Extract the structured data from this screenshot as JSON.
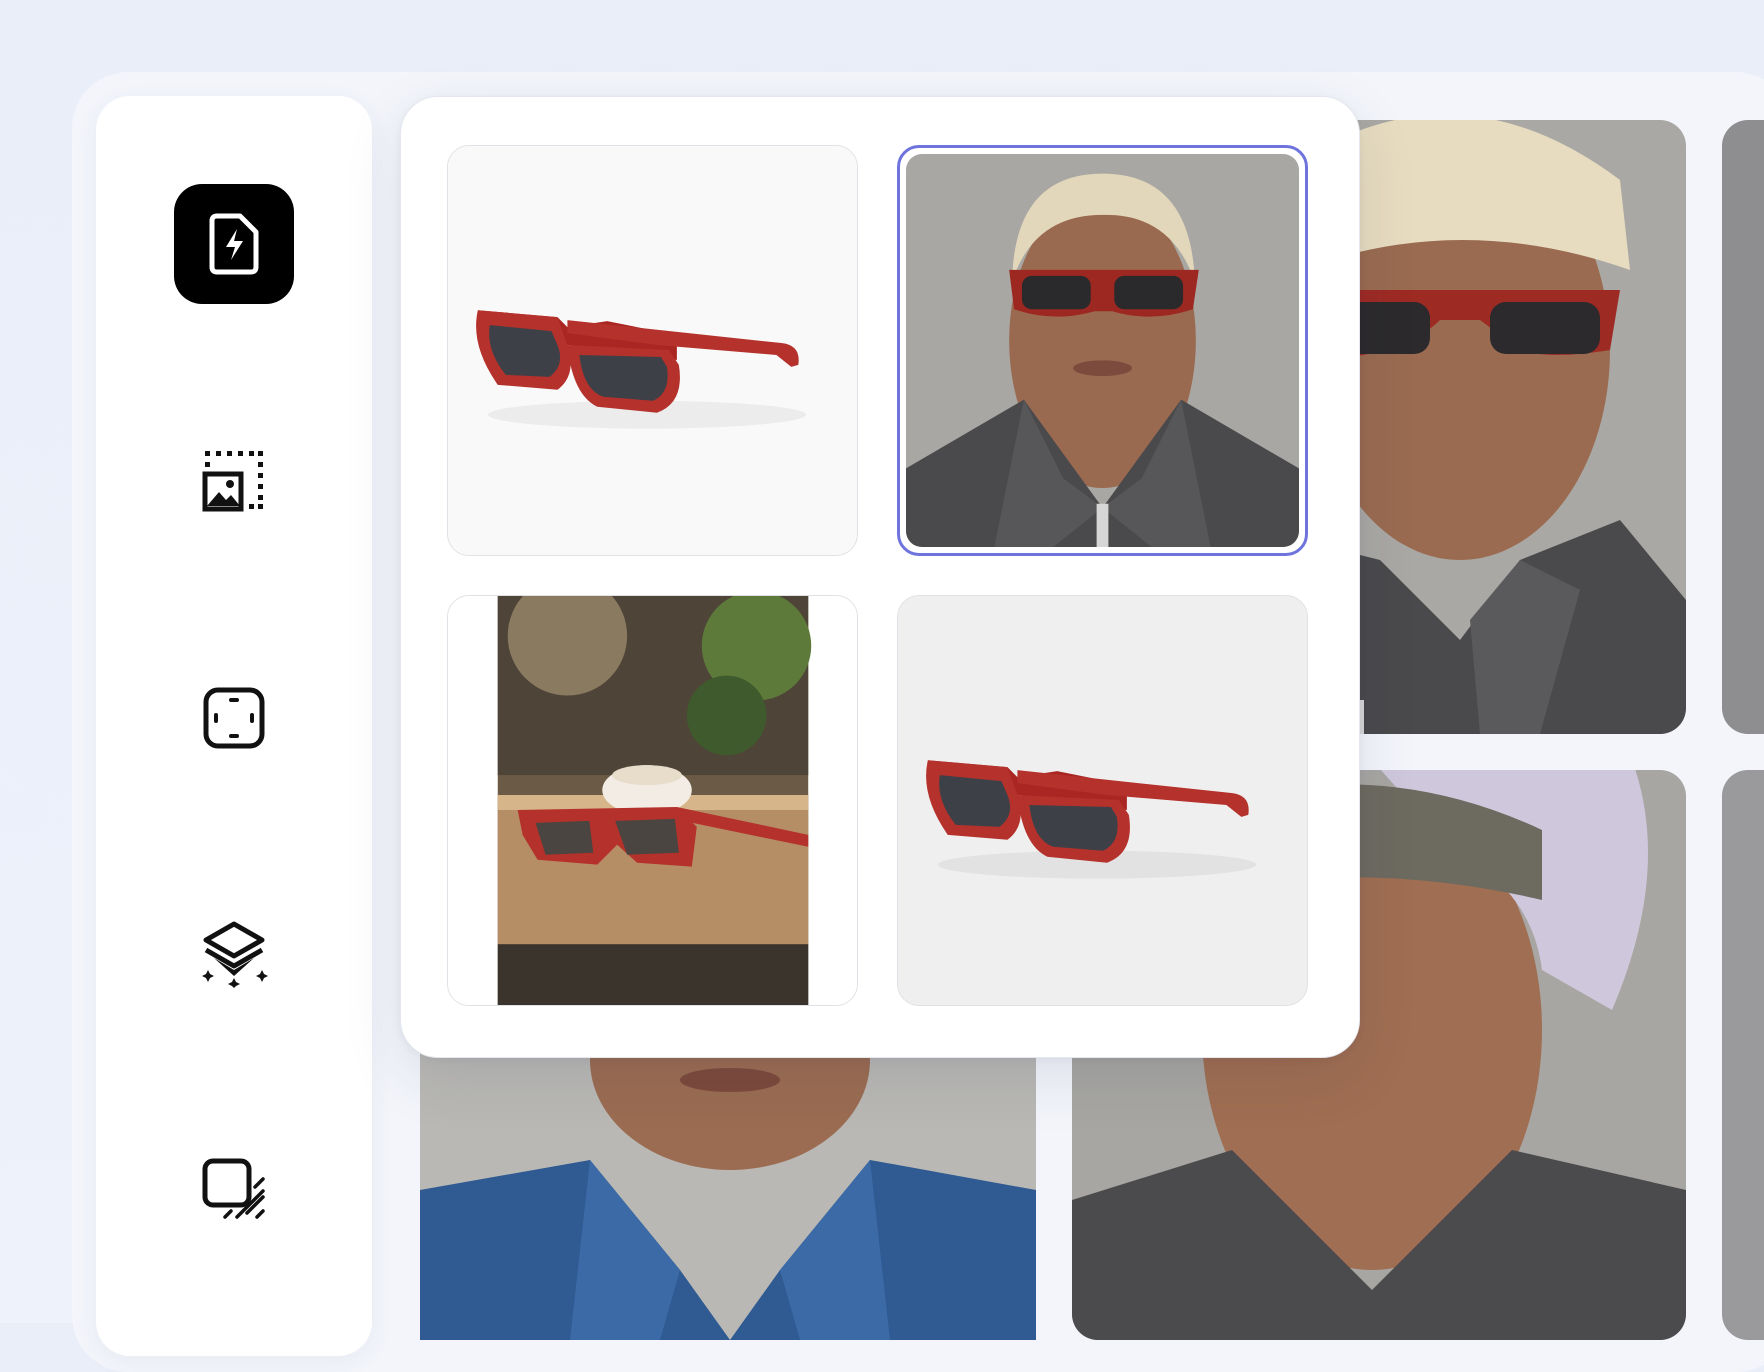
{
  "toolbar": {
    "items": [
      {
        "name": "generate-file-icon",
        "active": true
      },
      {
        "name": "image-crop-icon",
        "active": false
      },
      {
        "name": "focus-frame-icon",
        "active": false
      },
      {
        "name": "layers-sparkle-icon",
        "active": false
      },
      {
        "name": "shadow-square-icon",
        "active": false
      }
    ]
  },
  "colors": {
    "accent": "#6f74dd",
    "active_tool_bg": "#000000",
    "frame_red": "#b8302a",
    "lens": "#3b3d44"
  },
  "gallery": {
    "thumbnails": [
      {
        "id": "product-sunglasses-white",
        "selected": false
      },
      {
        "id": "model-portrait-sunglasses",
        "selected": true
      },
      {
        "id": "lifestyle-cafe-table",
        "selected": false
      },
      {
        "id": "product-sunglasses-grey",
        "selected": false
      }
    ]
  }
}
